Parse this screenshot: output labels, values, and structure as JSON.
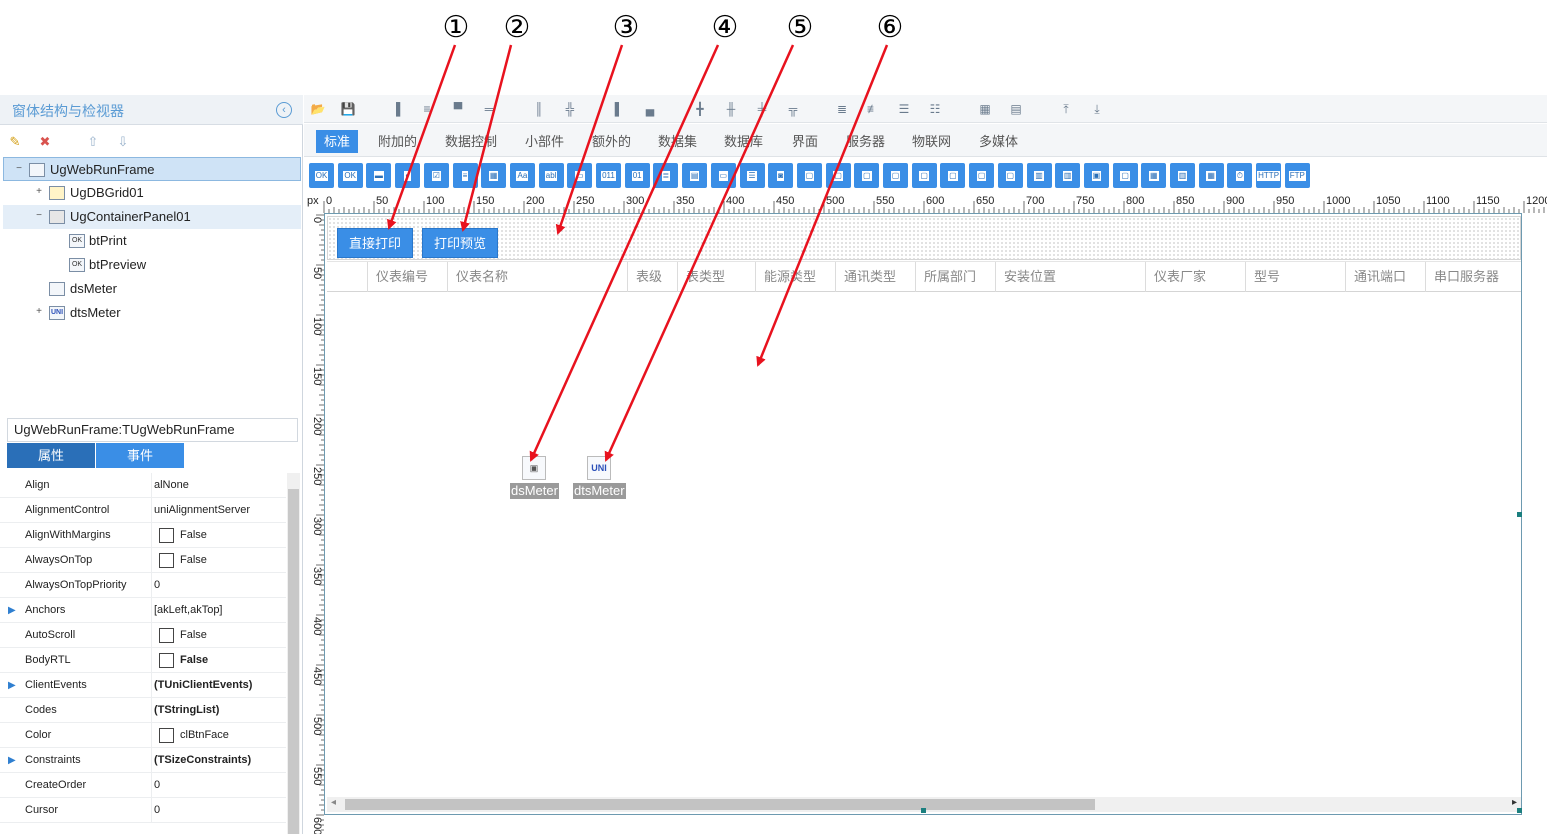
{
  "callouts": [
    "①",
    "②",
    "③",
    "④",
    "⑤",
    "⑥"
  ],
  "left_panel": {
    "title": "窗体结构与检视器",
    "collapse_icon": "chevron-left-icon",
    "toolbar_icons": [
      "add-node-icon",
      "remove-node-icon",
      "move-up-icon",
      "move-down-icon"
    ],
    "tree": [
      {
        "label": "UgWebRunFrame",
        "icon": "",
        "expander": "−"
      },
      {
        "label": "UgDBGrid01",
        "icon": "",
        "expander": "+"
      },
      {
        "label": "UgContainerPanel01",
        "icon": "",
        "expander": "−"
      },
      {
        "label": "btPrint",
        "icon": "OK",
        "expander": ""
      },
      {
        "label": "btPreview",
        "icon": "OK",
        "expander": ""
      },
      {
        "label": "dsMeter",
        "icon": "",
        "expander": ""
      },
      {
        "label": "dtsMeter",
        "icon": "UNI",
        "expander": "+"
      }
    ],
    "object_name": "UgWebRunFrame:TUgWebRunFrame",
    "tabs": [
      "属性",
      "事件"
    ]
  },
  "properties": [
    {
      "name": "Align",
      "value": "alNone",
      "type": "text"
    },
    {
      "name": "AlignmentControl",
      "value": "uniAlignmentServer",
      "type": "text"
    },
    {
      "name": "AlignWithMargins",
      "value": "False",
      "type": "check"
    },
    {
      "name": "AlwaysOnTop",
      "value": "False",
      "type": "check"
    },
    {
      "name": "AlwaysOnTopPriority",
      "value": "0",
      "type": "text"
    },
    {
      "name": "Anchors",
      "value": "[akLeft,akTop]",
      "type": "text",
      "expandable": true
    },
    {
      "name": "AutoScroll",
      "value": "False",
      "type": "check"
    },
    {
      "name": "BodyRTL",
      "value": "False",
      "type": "check",
      "bold": true
    },
    {
      "name": "ClientEvents",
      "value": "(TUniClientEvents)",
      "type": "text",
      "bold": true,
      "expandable": true
    },
    {
      "name": "Codes",
      "value": "(TStringList)",
      "type": "text",
      "bold": true
    },
    {
      "name": "Color",
      "value": "clBtnFace",
      "type": "check"
    },
    {
      "name": "Constraints",
      "value": "(TSizeConstraints)",
      "type": "text",
      "bold": true,
      "expandable": true
    },
    {
      "name": "CreateOrder",
      "value": "0",
      "type": "text"
    },
    {
      "name": "Cursor",
      "value": "0",
      "type": "text"
    }
  ],
  "toolbar": {
    "icons": [
      "open-folder-icon",
      "save-icon",
      "align-left-icon",
      "align-center-h-icon",
      "align-top-icon",
      "align-middle-icon",
      "space-equal-h-icon",
      "space-equal-h2-icon",
      "align-right-icon",
      "align-bottom-icon",
      "distribute-h-icon",
      "distribute-h2-icon",
      "distribute-v-icon",
      "distribute-v2-icon",
      "size-same-h-icon",
      "size-same-v-icon",
      "size-same-icon",
      "size-same2-icon",
      "grid-icon",
      "grid2-icon",
      "bring-front-icon",
      "send-back-icon"
    ]
  },
  "palette_tabs": [
    "标准",
    "附加的",
    "数据控制",
    "小部件",
    "额外的",
    "数据集",
    "数据库",
    "界面",
    "服务器",
    "物联网",
    "多媒体"
  ],
  "active_palette_tab": "标准",
  "palette_icons": [
    "OK",
    "OK",
    "▬",
    "◐",
    "☑",
    "≡",
    "▦",
    "Aa",
    "abl",
    "▭",
    "011",
    "01",
    "≣",
    "▤",
    "▭",
    "☰",
    "◙",
    "▢",
    "▢",
    "▢",
    "▢",
    "▢",
    "▢",
    "▢",
    "▢",
    "▥",
    "▥",
    "▣",
    "▢",
    "▦",
    "▥",
    "▦",
    "⏱",
    "HTTP",
    "FTP"
  ],
  "ruler": {
    "unit": "px",
    "h_labels": [
      "0",
      "50",
      "100",
      "150",
      "200",
      "250",
      "300",
      "350",
      "400",
      "450",
      "500",
      "550",
      "600",
      "650",
      "700",
      "750",
      "800",
      "850",
      "900",
      "950",
      "1000",
      "1050",
      "1100",
      "1150",
      "1200"
    ],
    "v_labels": [
      "0",
      "50",
      "100",
      "150",
      "200",
      "250",
      "300",
      "350",
      "400",
      "450",
      "500",
      "550",
      "600"
    ]
  },
  "canvas": {
    "buttons": [
      "直接打印",
      "打印预览"
    ],
    "grid_columns": [
      "仪表编号",
      "仪表名称",
      "表级",
      "表类型",
      "能源类型",
      "通讯类型",
      "所属部门",
      "安装位置",
      "仪表厂家",
      "型号",
      "通讯端口",
      "串口服务器"
    ],
    "components": [
      {
        "label": "dsMeter",
        "icon": "datasource-icon"
      },
      {
        "label": "dtsMeter",
        "icon": "dataset-icon"
      }
    ]
  },
  "colors": {
    "accent": "#3a8ee6",
    "arrow": "#e8121e",
    "title": "#5a9bd4"
  }
}
